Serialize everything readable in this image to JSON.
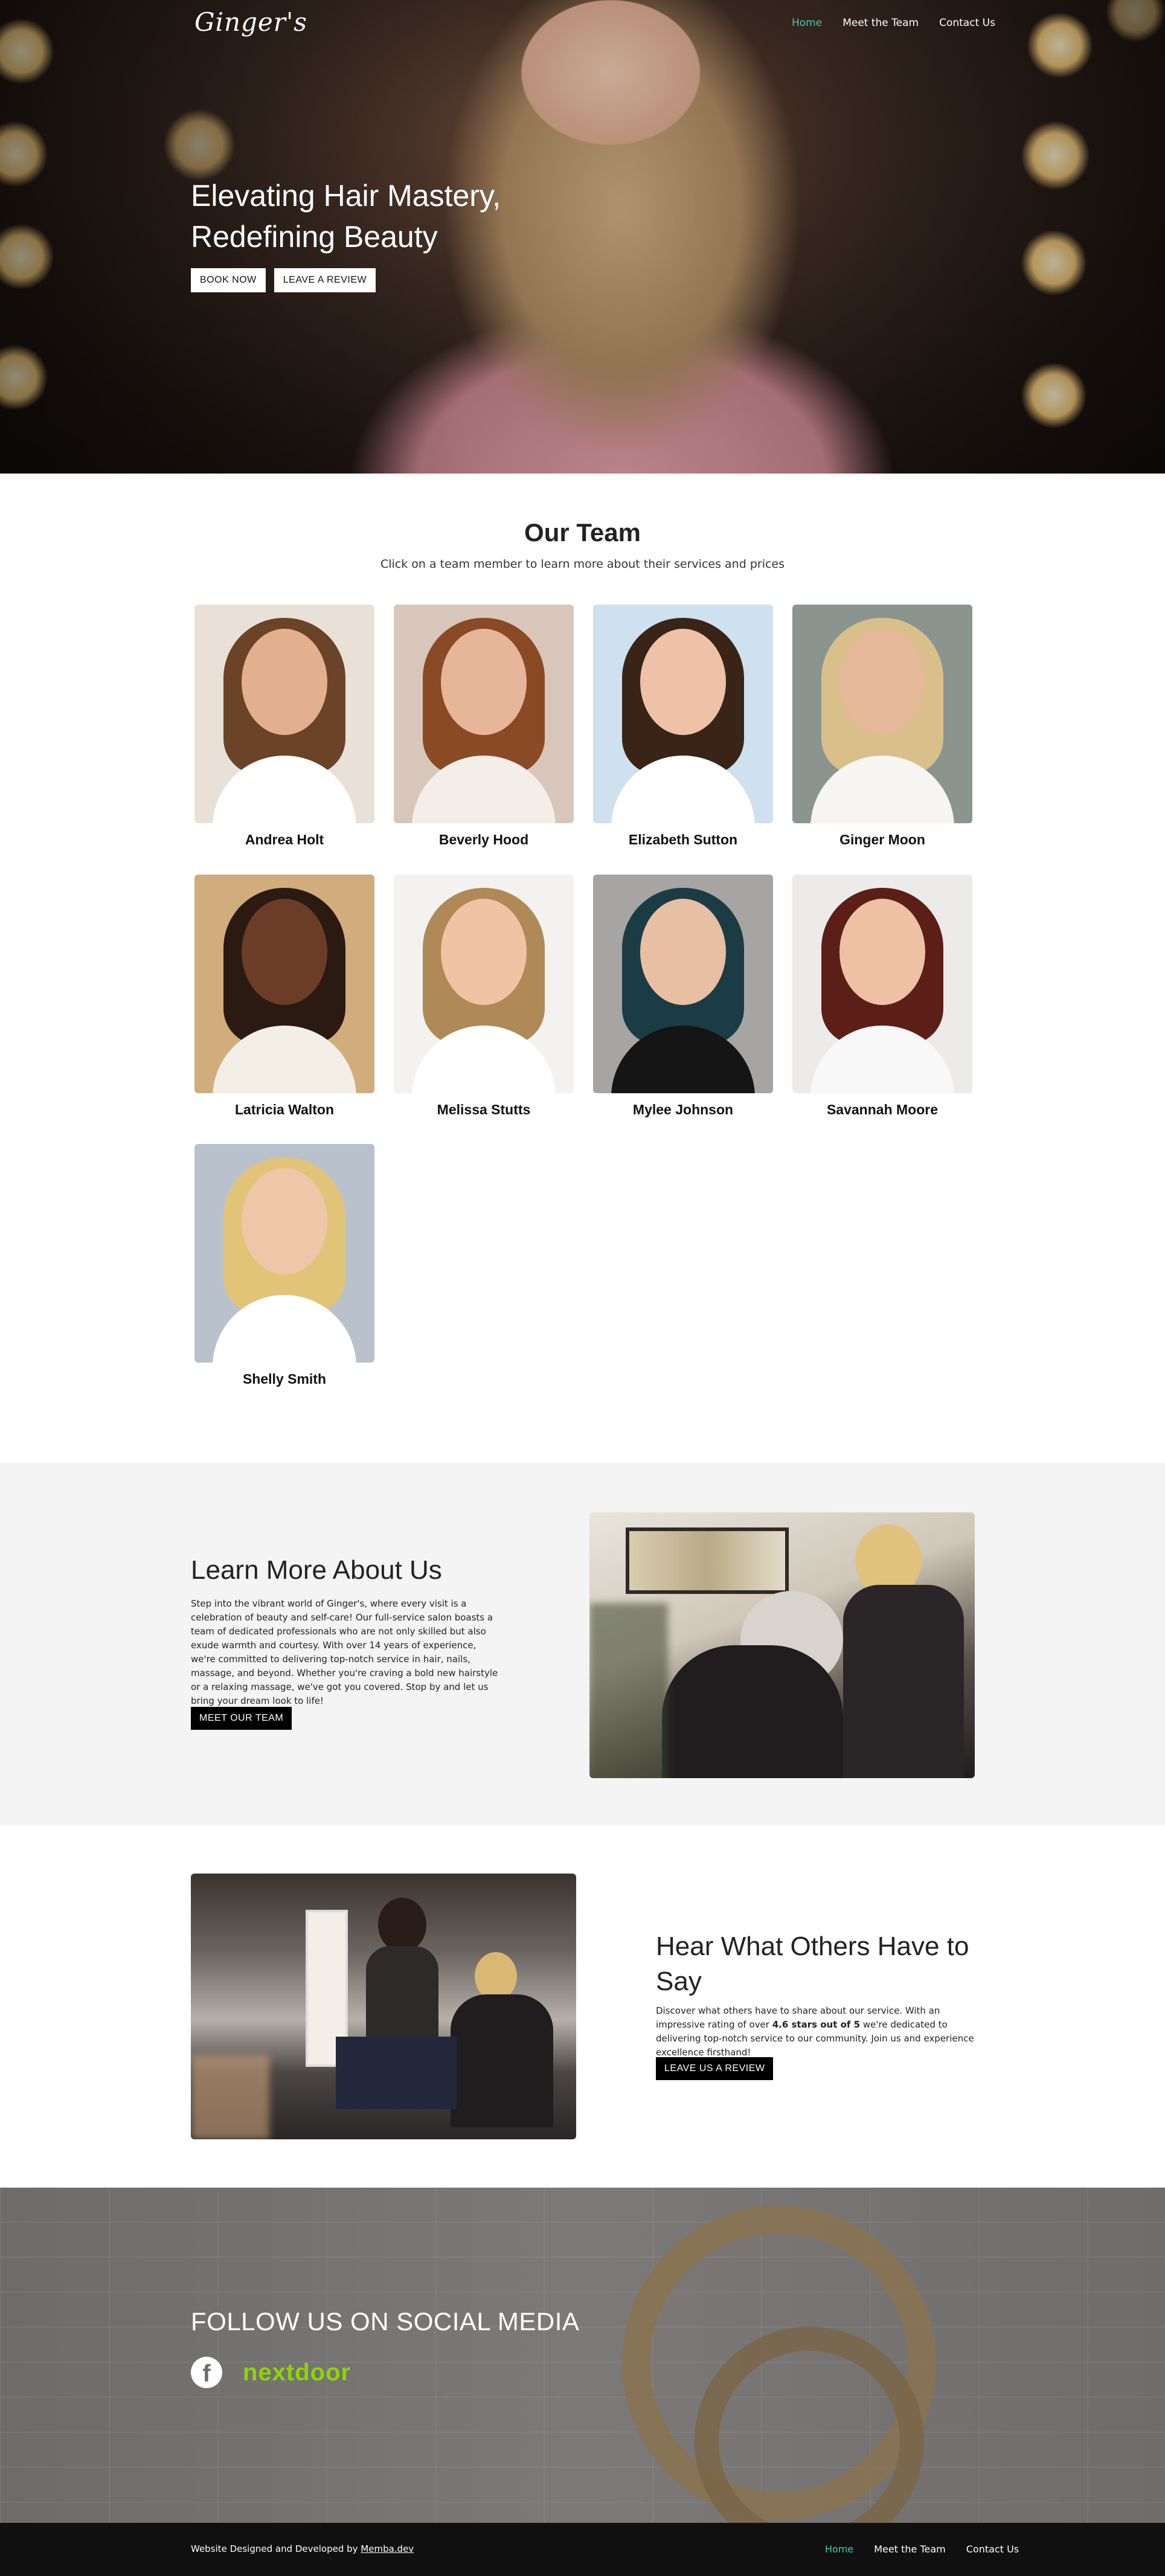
{
  "header": {
    "logo": "Ginger's",
    "nav": [
      "Home",
      "Meet the Team",
      "Contact Us"
    ]
  },
  "hero": {
    "title_line1": "Elevating Hair Mastery,",
    "title_line2": "Redefining Beauty",
    "book_label": "BOOK NOW",
    "review_label": "LEAVE A REVIEW"
  },
  "team": {
    "title": "Our Team",
    "subtitle": "Click on a team member to learn more about their services and prices",
    "members": [
      {
        "name": "Andrea Holt",
        "bg": "#e9e1d8",
        "face": "#e2b08f",
        "hair": "#6b4327",
        "top": "#ffffff"
      },
      {
        "name": "Beverly Hood",
        "bg": "#d9c6bb",
        "face": "#e7b69a",
        "hair": "#8a4a26",
        "top": "#f4eee8"
      },
      {
        "name": "Elizabeth Sutton",
        "bg": "#cfe0ee",
        "face": "#eec2a6",
        "hair": "#3a2418",
        "top": "#ffffff"
      },
      {
        "name": "Ginger Moon",
        "bg": "#8c9490",
        "face": "#e4b898",
        "hair": "#d9c08a",
        "top": "#f7f5f2"
      },
      {
        "name": "Latricia Walton",
        "bg": "#d1ad7e",
        "face": "#6b3d26",
        "hair": "#2a1a12",
        "top": "#f3eee6"
      },
      {
        "name": "Melissa Stutts",
        "bg": "#f3f2f0",
        "face": "#eec4a4",
        "hair": "#b08a56",
        "top": "#ffffff"
      },
      {
        "name": "Mylee Johnson",
        "bg": "#a7a5a3",
        "face": "#e7bfa2",
        "hair": "#1b3c44",
        "top": "#151515"
      },
      {
        "name": "Savannah Moore",
        "bg": "#ecebe9",
        "face": "#eec1a4",
        "hair": "#5b1f18",
        "top": "#f8f8f8"
      },
      {
        "name": "Shelly Smith",
        "bg": "#b9c2cc",
        "face": "#eec6a8",
        "hair": "#e2c479",
        "top": "#ffffff"
      }
    ]
  },
  "about": {
    "title": "Learn More About Us",
    "text": "Step into the vibrant world of Ginger's, where every visit is a celebration of beauty and self-care! Our full-service salon boasts a team of dedicated professionals who are not only skilled but also exude warmth and courtesy. With over 14 years of experience, we're committed to delivering top-notch service in hair, nails, massage, and beyond. Whether you're craving a bold new hairstyle or a relaxing massage, we've got you covered. Stop by and let us bring your dream look to life!",
    "button": "MEET OUR TEAM"
  },
  "reviews": {
    "title": "Hear What Others Have to Say",
    "text_before": "Discover what others have to share about our service. With an impressive rating of over ",
    "rating": "4.6 stars out of 5",
    "text_after": " we're dedicated to delivering top-notch service to our community. Join us and experience excellence firsthand!",
    "button": "LEAVE US A REVIEW"
  },
  "social": {
    "title": "FOLLOW US ON SOCIAL MEDIA",
    "facebook_glyph": "f",
    "nextdoor": "nextdoor"
  },
  "footer": {
    "credit_prefix": "Website Designed and Developed by ",
    "credit_link": "Memba.dev",
    "nav": [
      "Home",
      "Meet the Team",
      "Contact Us"
    ]
  },
  "colors": {
    "accent": "#4bc7b4",
    "nextdoor": "#8ed500"
  }
}
